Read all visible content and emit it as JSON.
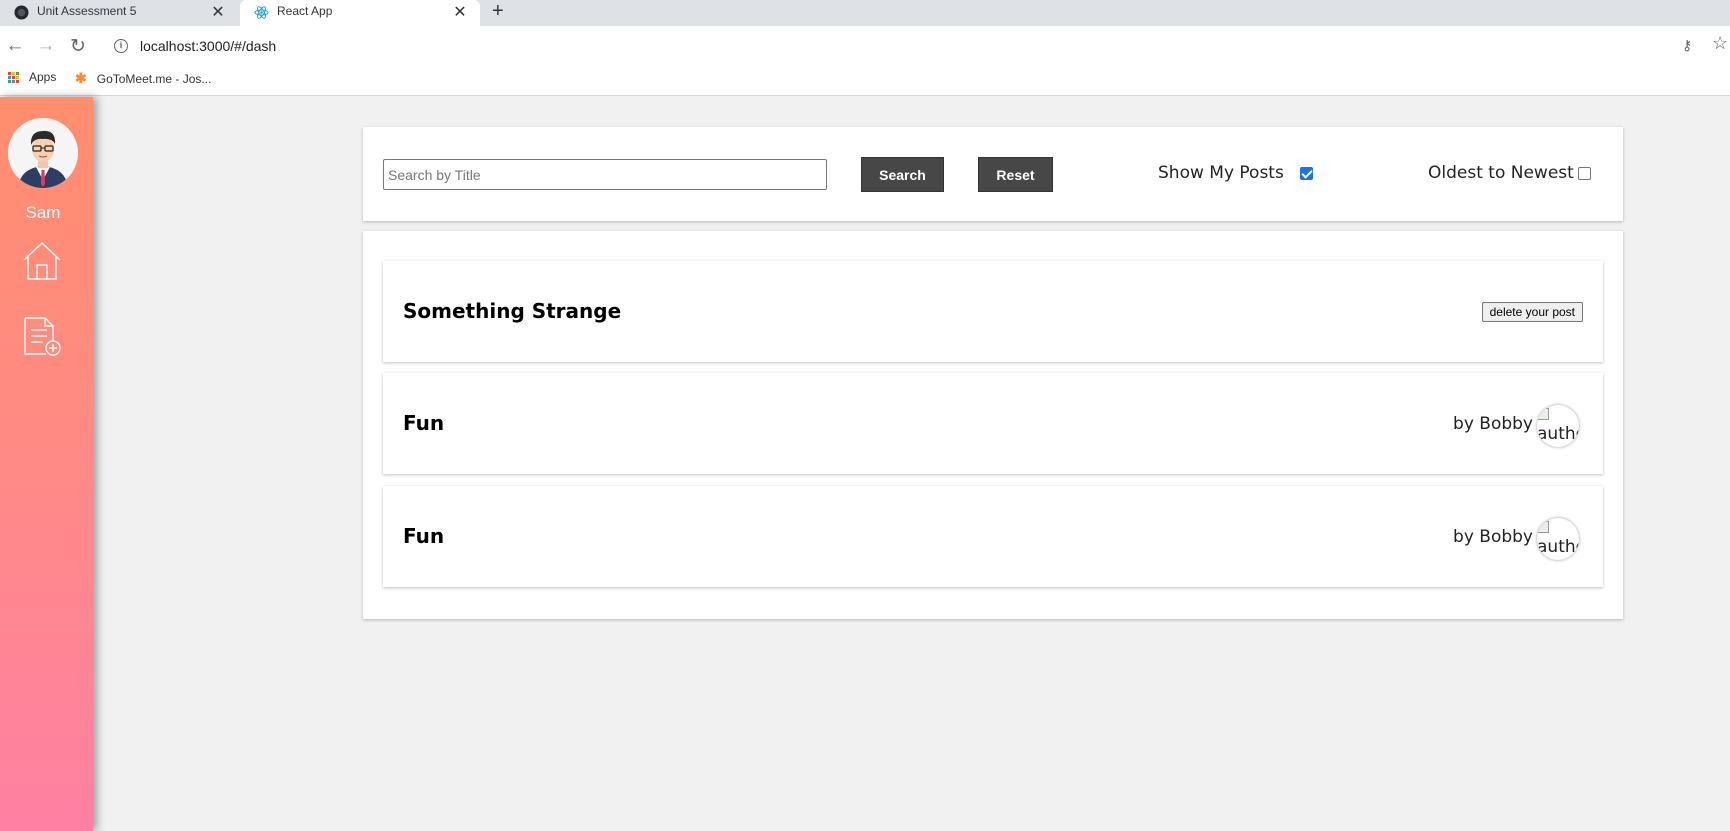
{
  "browser": {
    "tabs": [
      {
        "title": "Unit Assessment 5",
        "active": false,
        "icon": "github-icon"
      },
      {
        "title": "React App",
        "active": true,
        "icon": "react-icon"
      }
    ],
    "url": "localhost:3000/#/dash",
    "bookmarks": [
      {
        "label": "Apps",
        "icon": "apps-grid-icon"
      },
      {
        "label": "GoToMeet.me - Jos...",
        "icon": "gotomeeting-icon"
      }
    ]
  },
  "sidebar": {
    "user_name": "Sam",
    "nav": [
      {
        "name": "home",
        "icon": "home-icon"
      },
      {
        "name": "new-post",
        "icon": "new-post-icon"
      }
    ]
  },
  "filters": {
    "search_placeholder": "Search by Title",
    "search_value": "",
    "search_label": "Search",
    "reset_label": "Reset",
    "my_posts_label": "Show My Posts",
    "my_posts_checked": true,
    "oldest_label": "Oldest to Newest",
    "oldest_checked": false
  },
  "posts": [
    {
      "title": "Something Strange",
      "own": true,
      "delete_label": "delete your post"
    },
    {
      "title": "Fun",
      "own": false,
      "author_text": "by Bobby",
      "author_img_alt": "author"
    },
    {
      "title": "Fun",
      "own": false,
      "author_text": "by Bobby",
      "author_img_alt": "author"
    }
  ],
  "colors": {
    "sidebar_top": "#ff8e6e",
    "sidebar_bottom": "#ff80a3",
    "button_bg": "#474747",
    "checkbox_accent": "#1a73e8"
  }
}
